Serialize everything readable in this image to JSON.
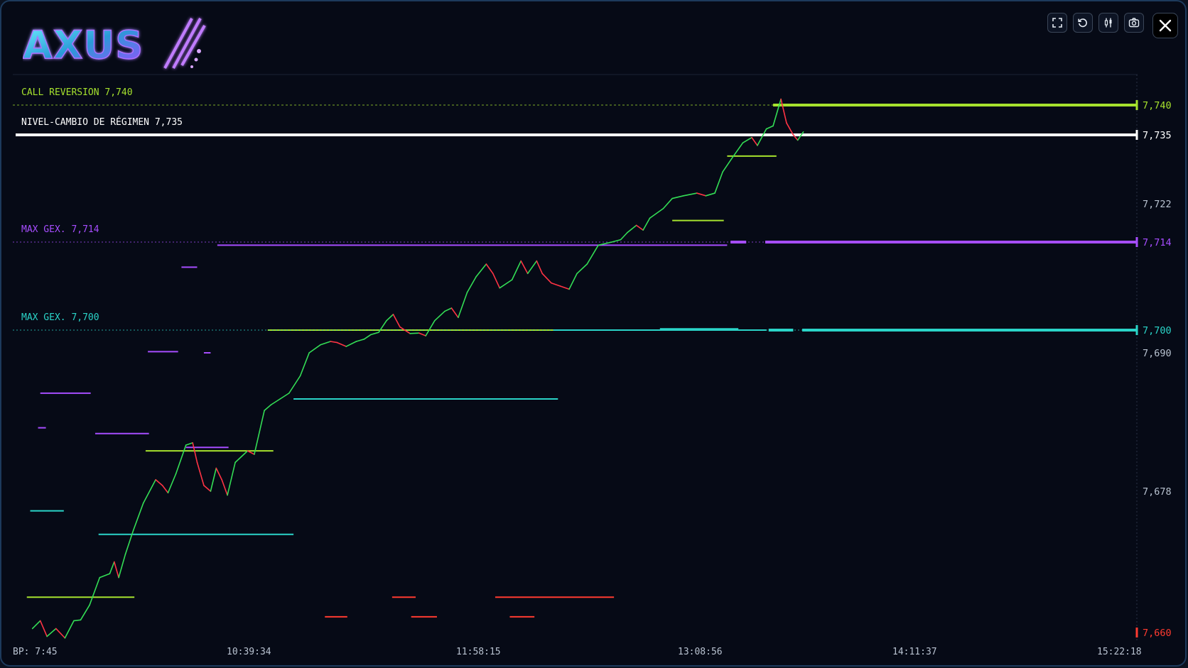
{
  "app": {
    "logo_text": "AXUS",
    "toolbar": [
      {
        "name": "fullscreen-icon",
        "label": "Fullscreen"
      },
      {
        "name": "reset-icon",
        "label": "Reset"
      },
      {
        "name": "candles-icon",
        "label": "Candles"
      },
      {
        "name": "camera-icon",
        "label": "Screenshot"
      }
    ],
    "close_icon": "close-icon"
  },
  "colors": {
    "background": "#060a16",
    "call": "#a6e22e",
    "regime": "#ffffff",
    "gex_purple": "#a64dff",
    "gex_cyan": "#2ad4c8",
    "put": "#ff3b30",
    "price_up": "#33dd55",
    "price_down": "#ff3344",
    "axis_text": "#b8c2d0"
  },
  "chart_data": {
    "type": "line",
    "y_axis": {
      "labels": [
        "7,740",
        "7,735",
        "7,722",
        "7,714",
        "7,700",
        "7,690",
        "7,678",
        "7,660"
      ],
      "highlighted": {
        "7,740": "call",
        "7,735": "regime",
        "7,714": "gex_purple",
        "7,700": "gex_cyan",
        "7,660": "put"
      },
      "range": [
        7659,
        7746
      ]
    },
    "x_axis": {
      "labels": [
        "BP: 7:45",
        "10:39:34",
        "11:58:15",
        "13:08:56",
        "14:11:37",
        "15:22:18"
      ]
    },
    "levels": [
      {
        "label": "CALL REVERSION 7,740",
        "value": 7740,
        "color": "call",
        "line": "dashed"
      },
      {
        "label": "NIVEL-CAMBIO DE RÉGIMEN  7,735",
        "value": 7735,
        "color": "regime",
        "line": "solid"
      },
      {
        "label": "MAX GEX. 7,714",
        "value": 7714,
        "color": "gex_purple",
        "line": "dotted"
      },
      {
        "label": "MAX GEX. 7,700",
        "value": 7700,
        "color": "gex_cyan",
        "line": "dotted"
      }
    ],
    "price_series": {
      "name": "",
      "x_range": [
        0,
        100
      ],
      "points": [
        [
          1.5,
          7660.5
        ],
        [
          2.2,
          7661.5
        ],
        [
          2.8,
          7659.5
        ],
        [
          3.6,
          7660.5
        ],
        [
          4.4,
          7659.3
        ],
        [
          5.2,
          7661.5
        ],
        [
          5.8,
          7661.6
        ],
        [
          6.6,
          7663.5
        ],
        [
          7.5,
          7667
        ],
        [
          8.4,
          7667.5
        ],
        [
          8.8,
          7669
        ],
        [
          9.2,
          7667
        ],
        [
          9.8,
          7670
        ],
        [
          10.5,
          7673
        ],
        [
          11.4,
          7676.5
        ],
        [
          12.5,
          7679
        ],
        [
          13.1,
          7678.5
        ],
        [
          13.6,
          7677.8
        ],
        [
          14.3,
          7679.5
        ],
        [
          15.2,
          7682
        ],
        [
          15.8,
          7682.2
        ],
        [
          16.2,
          7680.5
        ],
        [
          16.8,
          7678.5
        ],
        [
          17.4,
          7678
        ],
        [
          17.9,
          7680
        ],
        [
          18.4,
          7679
        ],
        [
          18.9,
          7677.5
        ],
        [
          19.6,
          7680.5
        ],
        [
          20.7,
          7681.5
        ],
        [
          21.3,
          7681.2
        ],
        [
          22.2,
          7685
        ],
        [
          22.8,
          7685.5
        ],
        [
          23.6,
          7686
        ],
        [
          24.4,
          7686.5
        ],
        [
          25.4,
          7688
        ],
        [
          26.2,
          7690
        ],
        [
          27.2,
          7693.5
        ],
        [
          28.1,
          7695
        ],
        [
          28.7,
          7694.5
        ],
        [
          29.5,
          7692.8
        ],
        [
          30.4,
          7695
        ],
        [
          31.1,
          7696
        ],
        [
          31.7,
          7698
        ],
        [
          32.4,
          7699
        ],
        [
          33.1,
          7701.5
        ],
        [
          33.7,
          7702.5
        ],
        [
          34.3,
          7700.5
        ],
        [
          35.2,
          7698.5
        ],
        [
          36.0,
          7698.7
        ],
        [
          36.6,
          7697.5
        ],
        [
          37.4,
          7701.5
        ],
        [
          38.3,
          7703
        ],
        [
          38.9,
          7703.5
        ],
        [
          39.5,
          7702
        ],
        [
          40.3,
          7706
        ],
        [
          41.1,
          7708.5
        ],
        [
          42.0,
          7710.5
        ],
        [
          42.6,
          7709
        ],
        [
          43.2,
          7706.7
        ],
        [
          44.3,
          7708
        ],
        [
          45.1,
          7711
        ],
        [
          45.7,
          7709
        ],
        [
          46.5,
          7711
        ],
        [
          47.0,
          7709
        ],
        [
          47.8,
          7707.5
        ],
        [
          48.6,
          7707
        ],
        [
          49.4,
          7706.5
        ],
        [
          50.1,
          7709
        ],
        [
          51.0,
          7710.5
        ],
        [
          52.0,
          7713.5
        ],
        [
          53.2,
          7714
        ],
        [
          54.0,
          7714.5
        ],
        [
          54.6,
          7716
        ],
        [
          55.4,
          7717.5
        ],
        [
          56.0,
          7716.5
        ],
        [
          56.6,
          7719
        ],
        [
          57.8,
          7721
        ],
        [
          58.6,
          7723
        ],
        [
          59.6,
          7723.5
        ],
        [
          60.8,
          7724
        ],
        [
          61.6,
          7723.5
        ],
        [
          62.4,
          7724
        ],
        [
          63.1,
          7728
        ],
        [
          63.9,
          7730.5
        ],
        [
          64.9,
          7733.5
        ],
        [
          65.7,
          7734.5
        ],
        [
          66.2,
          7733
        ],
        [
          67.0,
          7736
        ],
        [
          67.6,
          7736.5
        ],
        [
          68.3,
          7741
        ],
        [
          68.8,
          7737
        ],
        [
          69.4,
          7735
        ],
        [
          69.8,
          7734
        ],
        [
          70.3,
          7735.5
        ]
      ]
    },
    "level_segments": [
      {
        "color": "call",
        "value": 7740,
        "x0": 67.6,
        "x1": 100,
        "weight": 4
      },
      {
        "color": "gex_purple",
        "value": 7714,
        "x0": 63.8,
        "x1": 65.2,
        "weight": 4
      },
      {
        "color": "gex_purple",
        "value": 7714,
        "x0": 66.9,
        "x1": 100,
        "weight": 4
      },
      {
        "color": "gex_purple",
        "value": 7713.5,
        "x0": 18.0,
        "x1": 63.5,
        "weight": 2
      },
      {
        "color": "gex_cyan",
        "value": 7700,
        "x0": 48.0,
        "x1": 67.0,
        "weight": 2
      },
      {
        "color": "gex_cyan",
        "value": 7700,
        "x0": 67.2,
        "x1": 69.4,
        "weight": 4
      },
      {
        "color": "gex_cyan",
        "value": 7700,
        "x0": 70.2,
        "x1": 100,
        "weight": 4
      },
      {
        "color": "call",
        "value": 7700,
        "x0": 22.5,
        "x1": 48.0,
        "weight": 2
      },
      {
        "color": "call",
        "value": 7731,
        "x0": 63.5,
        "x1": 67.9,
        "weight": 2
      },
      {
        "color": "call",
        "value": 7718.5,
        "x0": 58.6,
        "x1": 63.2,
        "weight": 2
      },
      {
        "color": "call",
        "value": 7681.5,
        "x0": 11.6,
        "x1": 23.0,
        "weight": 2
      },
      {
        "color": "call",
        "value": 7664.5,
        "x0": 1.0,
        "x1": 10.6,
        "weight": 2
      },
      {
        "color": "gex_cyan",
        "value": 7686,
        "x0": 24.8,
        "x1": 48.4,
        "weight": 2
      },
      {
        "color": "gex_cyan",
        "value": 7672.5,
        "x0": 7.4,
        "x1": 24.8,
        "weight": 2
      },
      {
        "color": "gex_cyan",
        "value": 7675.5,
        "x0": 1.3,
        "x1": 4.3,
        "weight": 2
      },
      {
        "color": "gex_purple",
        "value": 7686.5,
        "x0": 2.2,
        "x1": 6.7,
        "weight": 2
      },
      {
        "color": "gex_purple",
        "value": 7683,
        "x0": 7.1,
        "x1": 11.9,
        "weight": 2
      },
      {
        "color": "gex_purple",
        "value": 7683.5,
        "x0": 2.0,
        "x1": 2.7,
        "weight": 2
      },
      {
        "color": "gex_purple",
        "value": 7681.8,
        "x0": 15.2,
        "x1": 19.0,
        "weight": 2
      },
      {
        "color": "gex_purple",
        "value": 7690.5,
        "x0": 11.8,
        "x1": 14.5,
        "weight": 2
      },
      {
        "color": "gex_purple",
        "value": 7690,
        "x0": 16.8,
        "x1": 17.4,
        "weight": 2
      },
      {
        "color": "gex_purple",
        "value": 7710,
        "x0": 14.8,
        "x1": 16.2,
        "weight": 2
      },
      {
        "color": "put",
        "value": 7664.5,
        "x0": 33.6,
        "x1": 35.7,
        "weight": 2
      },
      {
        "color": "put",
        "value": 7664.5,
        "x0": 42.8,
        "x1": 53.4,
        "weight": 2
      },
      {
        "color": "put",
        "value": 7662,
        "x0": 27.6,
        "x1": 29.6,
        "weight": 2
      },
      {
        "color": "put",
        "value": 7662,
        "x0": 35.3,
        "x1": 37.6,
        "weight": 2
      },
      {
        "color": "put",
        "value": 7662,
        "x0": 44.1,
        "x1": 46.3,
        "weight": 2
      },
      {
        "color": "gex_cyan",
        "value": 7700.2,
        "x0": 57.5,
        "x1": 64.5,
        "weight": 2
      }
    ]
  }
}
